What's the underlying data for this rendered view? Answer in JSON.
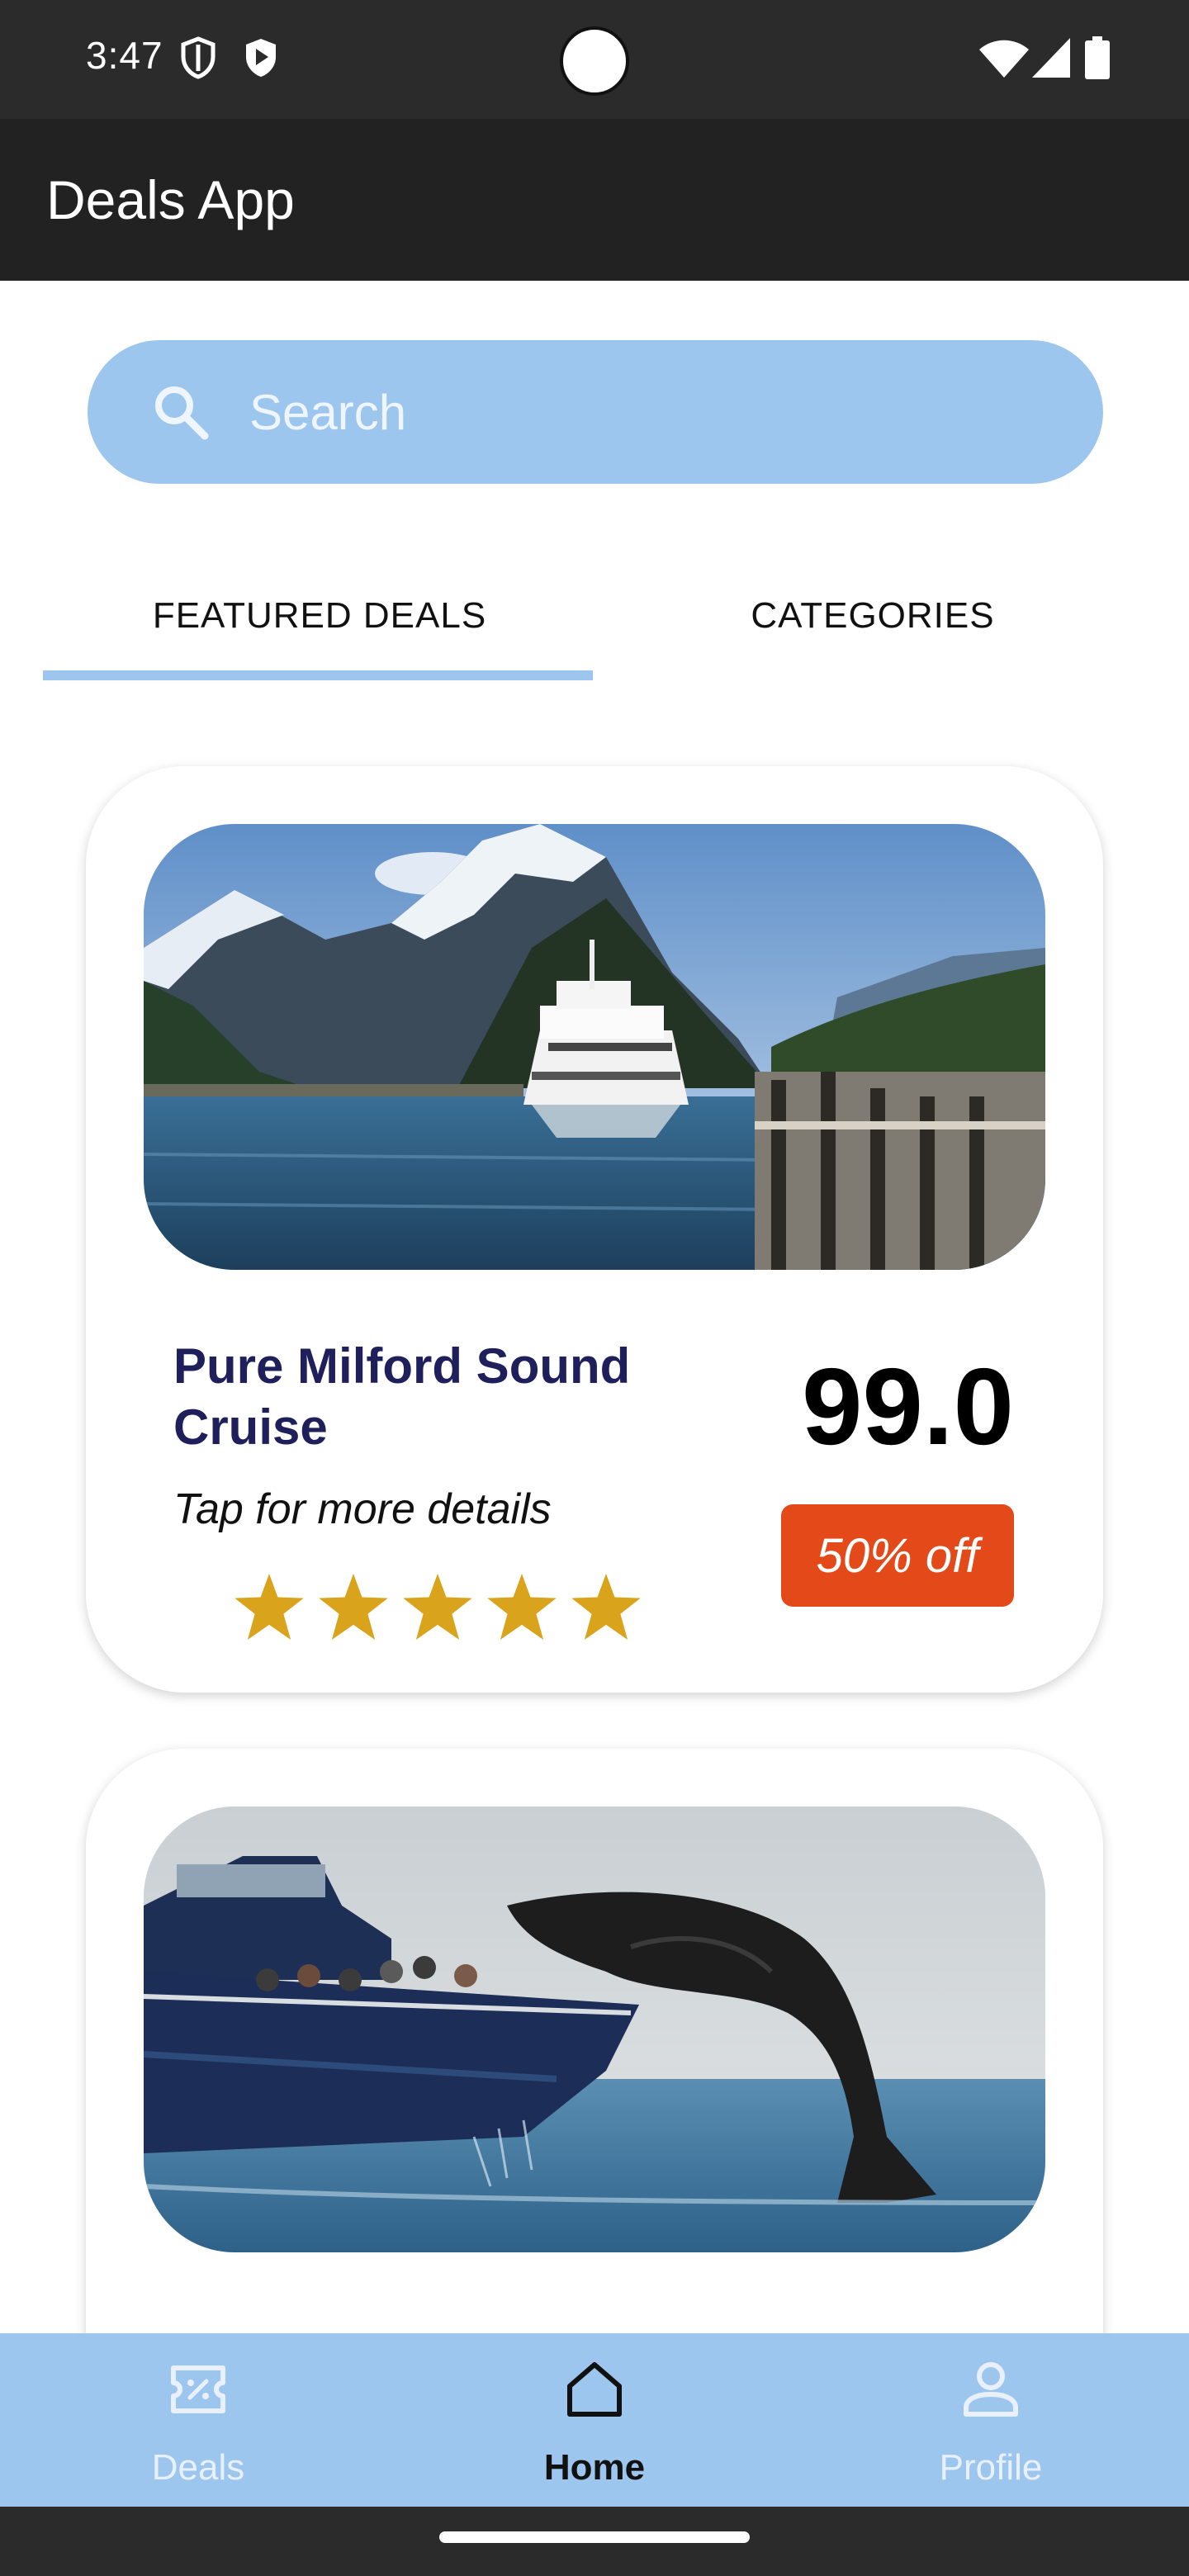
{
  "status_bar": {
    "time": "3:47",
    "icons": [
      "shield-icon",
      "play-shield-icon",
      "wifi-icon",
      "signal-icon",
      "battery-icon"
    ]
  },
  "app_bar": {
    "title": "Deals App"
  },
  "search": {
    "placeholder": "Search",
    "value": ""
  },
  "tabs": [
    {
      "label": "FEATURED DEALS",
      "selected": true
    },
    {
      "label": "CATEGORIES",
      "selected": false
    }
  ],
  "deals": [
    {
      "title": "Pure Milford Sound Cruise",
      "subtitle": "Tap for more details",
      "price": "99.0",
      "discount": "50% off",
      "rating": 5
    },
    {}
  ],
  "bottom_nav": [
    {
      "label": "Deals",
      "icon": "deal-ticket-icon",
      "selected": false
    },
    {
      "label": "Home",
      "icon": "home-icon",
      "selected": true
    },
    {
      "label": "Profile",
      "icon": "person-icon",
      "selected": false
    }
  ],
  "colors": {
    "accent": "#9dc6ee",
    "app_bar": "#222222",
    "deal_title": "#1f1f5c",
    "discount_badge": "#e44a19",
    "star": "#d9a31b"
  }
}
